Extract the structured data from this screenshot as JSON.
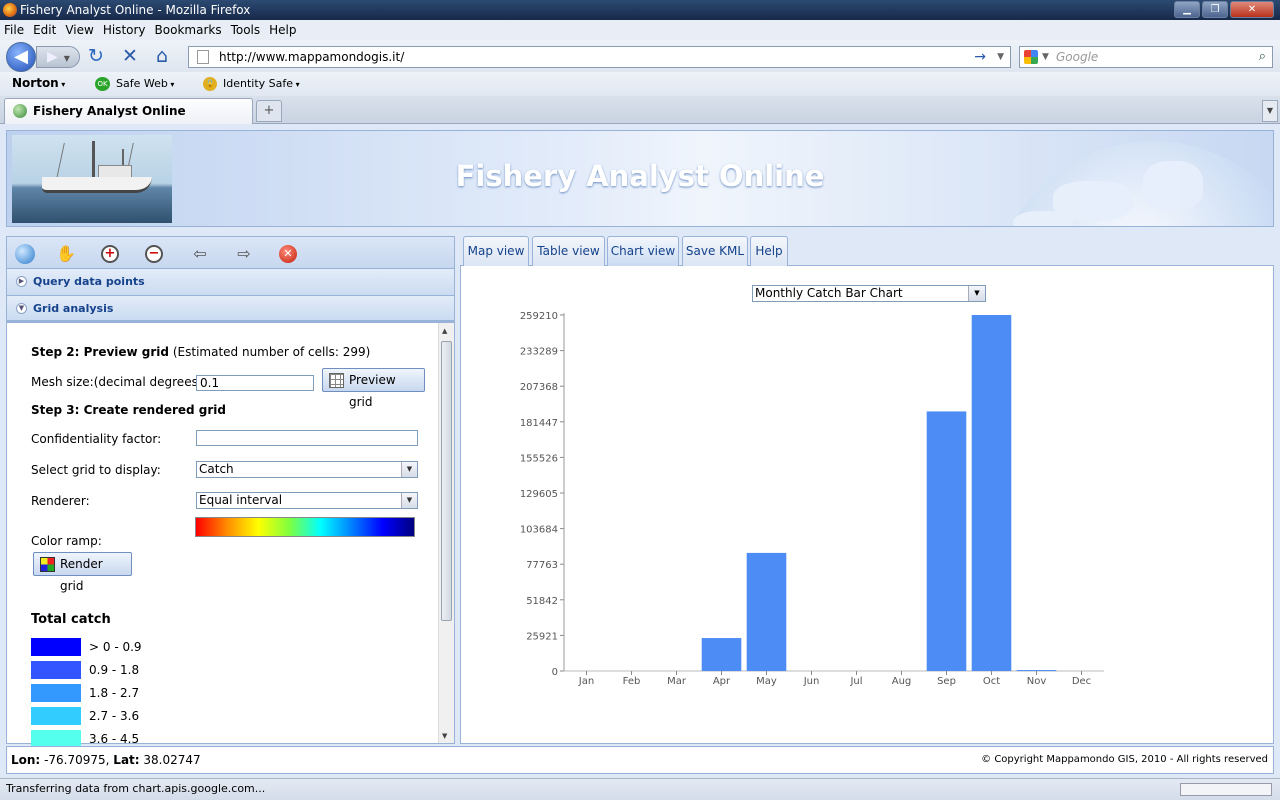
{
  "window": {
    "title": "Fishery Analyst Online - Mozilla Firefox"
  },
  "menu": [
    "File",
    "Edit",
    "View",
    "History",
    "Bookmarks",
    "Tools",
    "Help"
  ],
  "nav": {
    "url": "http://www.mappamondogis.it/",
    "search_placeholder": "Google"
  },
  "norton": {
    "brand": "Norton",
    "safe_web": "Safe Web",
    "safe_web_badge": "OK",
    "identity_safe": "Identity Safe"
  },
  "browser_tab": {
    "label": "Fishery Analyst Online"
  },
  "banner": {
    "title": "Fishery Analyst Online"
  },
  "left_panel": {
    "sections": {
      "query": "Query data points",
      "grid": "Grid analysis"
    },
    "step2": {
      "title": "Step 2: Preview grid",
      "note": "(Estimated number of cells: 299)"
    },
    "mesh": {
      "label": "Mesh size:(decimal degrees)",
      "value": "0.1",
      "button": "Preview grid"
    },
    "step3": {
      "title": "Step 3: Create rendered grid"
    },
    "confidentiality": {
      "label": "Confidentiality factor:",
      "value": ""
    },
    "grid_select": {
      "label": "Select grid to display:",
      "value": "Catch"
    },
    "renderer": {
      "label": "Renderer:",
      "value": "Equal interval"
    },
    "color_ramp": {
      "label": "Color ramp:"
    },
    "render_button": "Render grid",
    "legend": {
      "title": "Total catch",
      "items": [
        {
          "label": "> 0 - 0.9",
          "color": "#0000ff"
        },
        {
          "label": "0.9 - 1.8",
          "color": "#3355ff"
        },
        {
          "label": "1.8 - 2.7",
          "color": "#3399ff"
        },
        {
          "label": "2.7 - 3.6",
          "color": "#33ccff"
        },
        {
          "label": "3.6 - 4.5",
          "color": "#55ffee"
        }
      ]
    }
  },
  "right_panel": {
    "tabs": [
      "Map view",
      "Table view",
      "Chart view",
      "Save KML",
      "Help"
    ],
    "active_tab": "Chart view",
    "chart_select": "Monthly Catch Bar Chart"
  },
  "chart_data": {
    "type": "bar",
    "categories": [
      "Jan",
      "Feb",
      "Mar",
      "Apr",
      "May",
      "Jun",
      "Jul",
      "Aug",
      "Sep",
      "Oct",
      "Nov",
      "Dec"
    ],
    "values": [
      0,
      0,
      0,
      24000,
      86000,
      0,
      0,
      0,
      189000,
      259210,
      700,
      0
    ],
    "yticks": [
      "0",
      "25921",
      "51842",
      "77763",
      "103684",
      "129605",
      "155526",
      "181447",
      "207368",
      "233289",
      "259210"
    ],
    "ylim": [
      0,
      259210
    ],
    "bar_color": "#4d8cf5",
    "title": "",
    "xlabel": "",
    "ylabel": ""
  },
  "status": {
    "lon_label": "Lon:",
    "lon": "-76.70975",
    "lat_label": "Lat:",
    "lat": "38.02747",
    "copyright": "© Copyright Mappamondo GIS, 2010 - All rights reserved"
  },
  "browser_status": "Transferring data from chart.apis.google.com..."
}
